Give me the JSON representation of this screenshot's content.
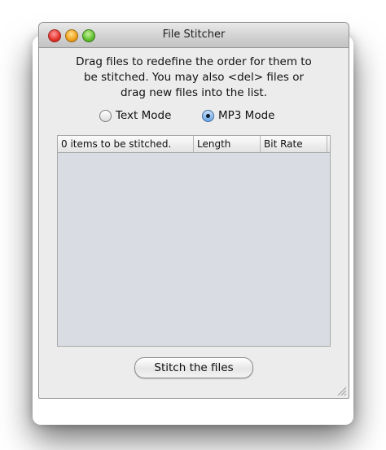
{
  "window": {
    "title": "File Stitcher"
  },
  "instructions": {
    "line1": "Drag files to redefine the order for them to",
    "line2": "be stitched.  You may also <del> files or",
    "line3": "drag new files into the list."
  },
  "mode": {
    "text_label": "Text Mode",
    "mp3_label": "MP3 Mode",
    "selected": "MP3 Mode"
  },
  "table": {
    "columns": [
      "0 items to be stitched.",
      "Length",
      "Bit Rate"
    ],
    "rows": []
  },
  "action": {
    "stitch_label": "Stitch the files"
  }
}
